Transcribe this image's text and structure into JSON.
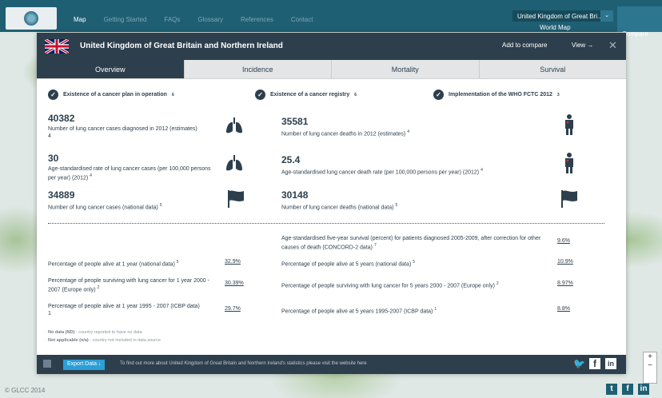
{
  "nav": {
    "items": [
      "Map",
      "Getting Started",
      "FAQs",
      "Glossary",
      "References",
      "Contact"
    ],
    "country_select": "United Kingdom of Great Bri...",
    "map_select": "World Map",
    "compare_label": "Compare"
  },
  "footer": {
    "copyright": "© GLCC 2014"
  },
  "modal": {
    "title": "United Kingdom of Great Britain and Northern Ireland",
    "add_compare": "Add to compare",
    "view": "View →",
    "close": "✕",
    "tabs": [
      "Overview",
      "Incidence",
      "Mortality",
      "Survival"
    ],
    "checks": [
      {
        "label": "Existence of a cancer plan in operation",
        "sup": "6"
      },
      {
        "label": "Existence of a cancer registry",
        "sup": "6"
      },
      {
        "label": "Implementation of the WHO FCTC 2012",
        "sup": "3"
      }
    ],
    "stats_left": [
      {
        "num": "40382",
        "desc": "Number of lung cancer cases diagnosed in 2012 (estimates)",
        "sup": "4"
      },
      {
        "num": "30",
        "desc": "Age-standardised rate of lung cancer cases (per 100,000 persons per year) (2012)",
        "sup": "4"
      },
      {
        "num": "34889",
        "desc": "Number of lung cancer cases (national data)",
        "sup": "5"
      }
    ],
    "stats_right": [
      {
        "num": "35581",
        "desc": "Number of lung cancer deaths in 2012 (estimates)",
        "sup": "4"
      },
      {
        "num": "25.4",
        "desc": "Age-standardised lung cancer death rate (per 100,000 persons per year) (2012)",
        "sup": "4"
      },
      {
        "num": "30148",
        "desc": "Number of lung cancer deaths (national data)",
        "sup": "5"
      }
    ],
    "survival_header": {
      "text": "Age-standardised five-year survival (percent) for patients diagnosed 2005-2009, after correction for other causes of death (CONCORD-2 data)",
      "sup": "7",
      "value": "9.6%"
    },
    "survival_left": [
      {
        "label": "Percentage of people alive at 1 year (national data)",
        "sup": "5",
        "value": "32.9%"
      },
      {
        "label": "Percentage of people surviving with lung cancer for 1 year 2000 - 2007 (Europe only)",
        "sup": "2",
        "value": "30.39%"
      },
      {
        "label": "Percentage of people alive at 1 year 1995 - 2007 (ICBP data)",
        "sup": "1",
        "value": "29.7%"
      }
    ],
    "survival_right": [
      {
        "label": "Percentage of people alive at 5 years (national data)",
        "sup": "5",
        "value": "10.9%"
      },
      {
        "label": "Percentage of people surviving with lung cancer for 5 years 2000 - 2007 (Europe only)",
        "sup": "2",
        "value": "8.97%"
      },
      {
        "label": "Percentage of people alive at 5 years 1995-2007 (ICBP data)",
        "sup": "1",
        "value": "8.8%"
      }
    ],
    "notes": [
      {
        "bold": "No data (ND)",
        "text": " - country reported to have no data"
      },
      {
        "bold": "Not applicable (n/a)",
        "text": " - country not included in data source"
      }
    ],
    "export_label": "Export Data ↓",
    "footer_text": "To find out more about United Kingdom of Great Britain and Northern Ireland's statistics please visit the website here"
  }
}
